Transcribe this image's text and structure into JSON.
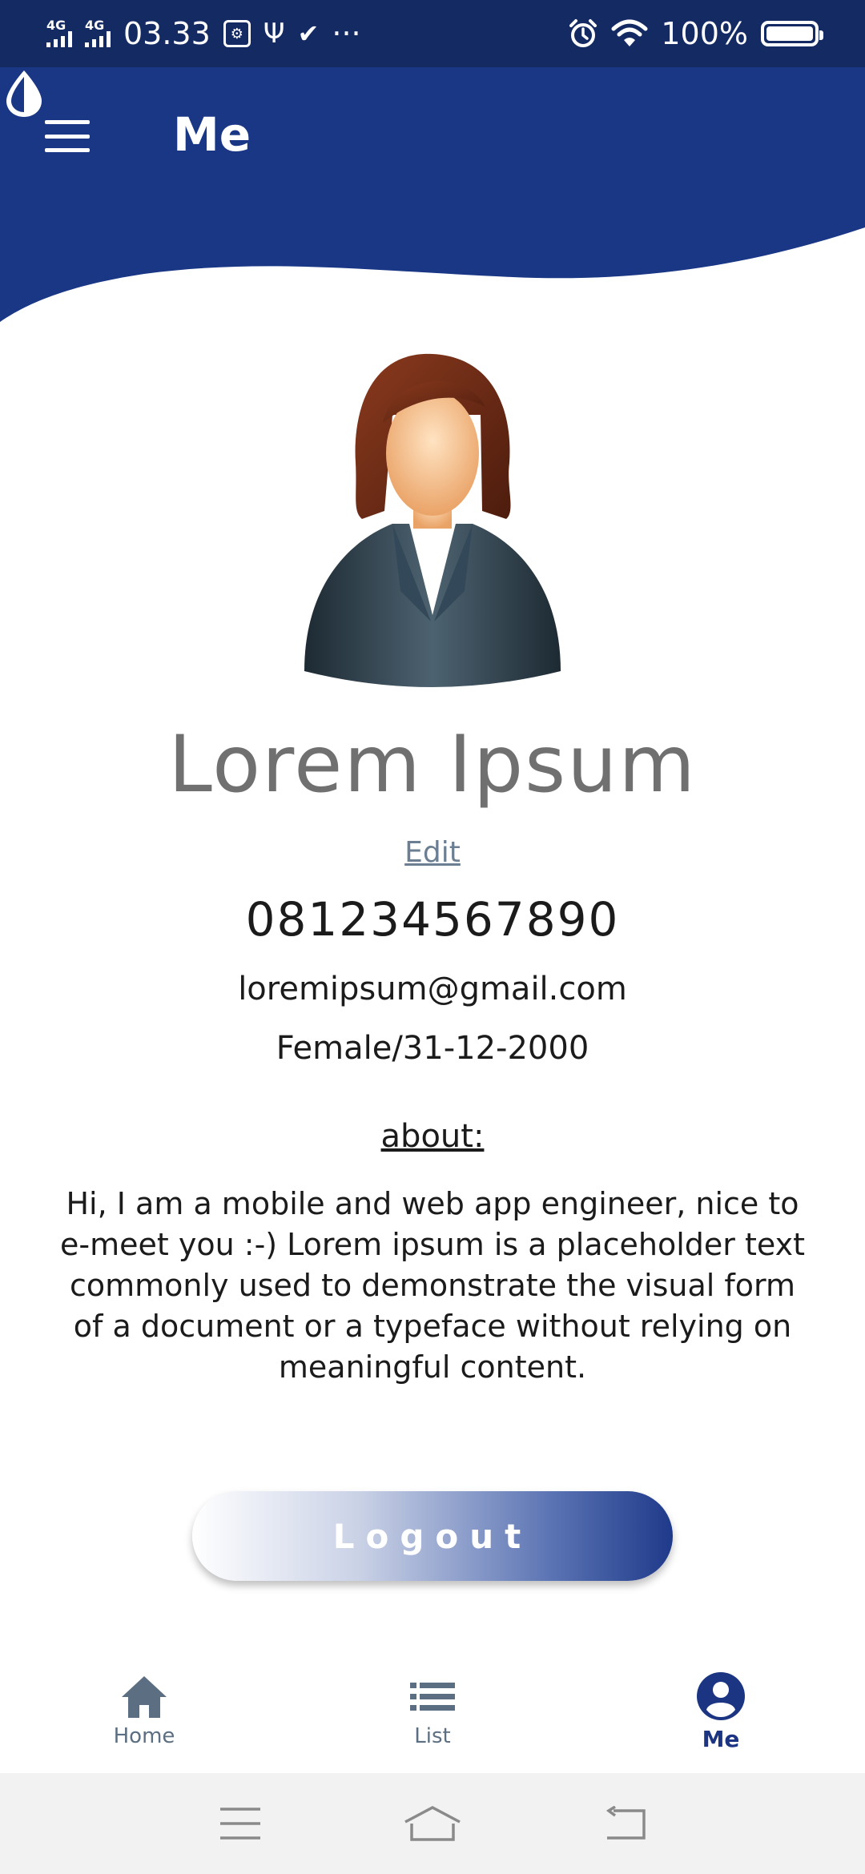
{
  "status_bar": {
    "network_1": "4G",
    "network_2": "4G",
    "time": "03.33",
    "more": "···",
    "battery": "100%",
    "icons": [
      "signal-icon",
      "usb-debug-icon",
      "usb-icon",
      "clipboard-check-icon",
      "alarm-icon",
      "wifi-icon",
      "battery-icon"
    ]
  },
  "header": {
    "title": "Me",
    "menu_icon": "hamburger-menu-icon",
    "theme_icon": "theme-drop-icon",
    "color": "#1a3786"
  },
  "profile": {
    "name": "Lorem Ipsum",
    "edit_label": "Edit",
    "phone": "081234567890",
    "email": "loremipsum@gmail.com",
    "gender_dob": "Female/31-12-2000",
    "about_heading": "about:",
    "about_text": "Hi, I am a mobile and web app engineer, nice to e-meet you :-) Lorem ipsum is a placeholder text commonly used to demonstrate the visual form of a document or a typeface without relying on meaningful content."
  },
  "logout_label": "Logout",
  "bottom_nav": {
    "items": [
      {
        "label": "Home",
        "icon": "home-icon",
        "active": false
      },
      {
        "label": "List",
        "icon": "list-icon",
        "active": false
      },
      {
        "label": "Me",
        "icon": "account-circle-icon",
        "active": true
      }
    ]
  },
  "system_nav": {
    "icons": [
      "recent-apps-icon",
      "home-outline-icon",
      "back-icon"
    ]
  },
  "colors": {
    "primary": "#1a3786",
    "status_bar": "#142a63",
    "inactive_nav": "#5c6f82",
    "name_gray": "#707070"
  }
}
